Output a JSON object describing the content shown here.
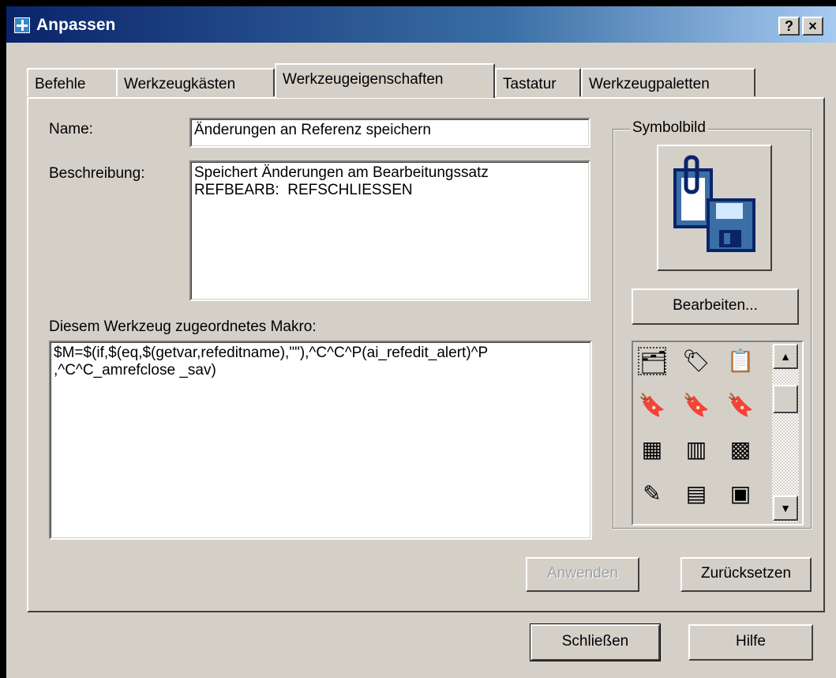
{
  "window": {
    "title": "Anpassen",
    "help_button": "?",
    "close_button": "×"
  },
  "tabs": [
    {
      "label": "Befehle"
    },
    {
      "label": "Werkzeugkästen"
    },
    {
      "label": "Werkzeugeigenschaften"
    },
    {
      "label": "Tastatur"
    },
    {
      "label": "Werkzeugpaletten"
    }
  ],
  "active_tab": "Werkzeugeigenschaften",
  "form": {
    "name_label": "Name:",
    "name_value": "Änderungen an Referenz speichern",
    "description_label": "Beschreibung:",
    "description_value": "Speichert Änderungen am Bearbeitungssatz\nREFBEARB:  REFSCHLIESSEN",
    "macro_label": "Diesem Werkzeug zugeordnetes Makro:",
    "macro_value": "$M=$(if,$(eq,$(getvar,refeditname),\"\"),^C^C^P(ai_refedit_alert)^P\n,^C^C_amrefclose _sav)"
  },
  "symbol": {
    "group_label": "Symbolbild",
    "edit_button": "Bearbeiten...",
    "icons": [
      "clip-save-icon",
      "tag-icon",
      "clipboard-icon",
      "tag-pink-icon",
      "tag-green-icon",
      "tag-blue-icon",
      "grid-dots-icon",
      "clip-grid-icon",
      "dotted-grid-icon",
      "pencil-icon",
      "grid-bar-icon",
      "picture-icon"
    ]
  },
  "buttons": {
    "apply": "Anwenden",
    "reset": "Zurücksetzen",
    "close": "Schließen",
    "help": "Hilfe"
  },
  "colors": {
    "title_start": "#0a246a",
    "title_end": "#a6caf0",
    "dialog_bg": "#d4d0c8"
  }
}
